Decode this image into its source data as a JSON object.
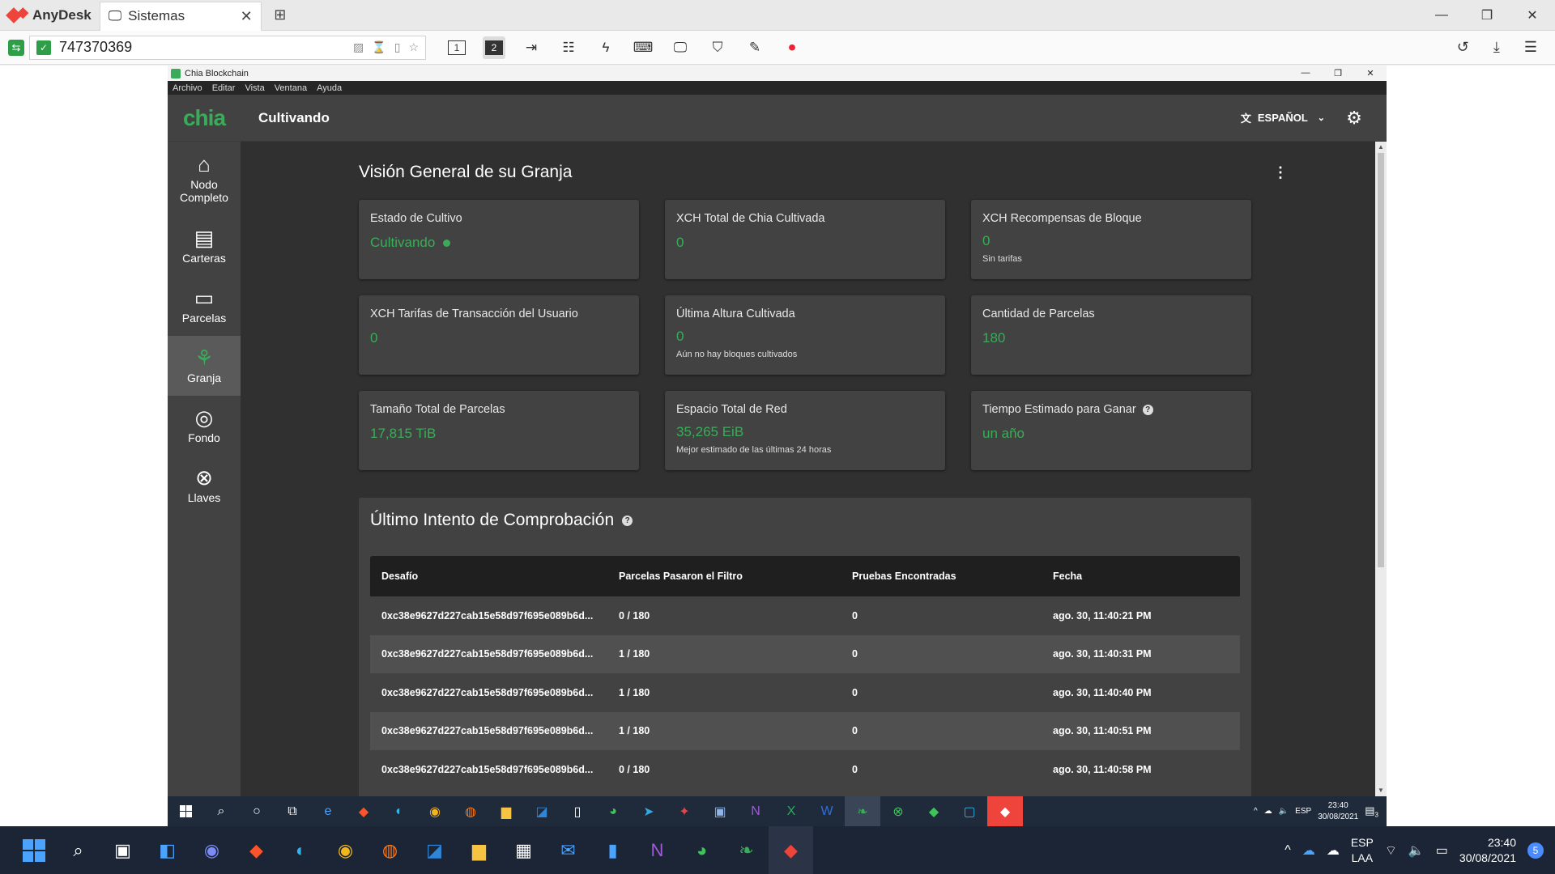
{
  "anydesk": {
    "app_name": "AnyDesk",
    "tab_label": "Sistemas",
    "address": "747370369"
  },
  "chia": {
    "window_title": "Chia Blockchain",
    "menu": [
      "Archivo",
      "Editar",
      "Vista",
      "Ventana",
      "Ayuda"
    ],
    "logo": "chia",
    "page_title": "Cultivando",
    "language": "ESPAÑOL",
    "sidebar": [
      {
        "label": "Nodo Completo",
        "icon": "home-icon"
      },
      {
        "label": "Carteras",
        "icon": "wallet-icon"
      },
      {
        "label": "Parcelas",
        "icon": "drive-icon"
      },
      {
        "label": "Granja",
        "icon": "sprout-icon"
      },
      {
        "label": "Fondo",
        "icon": "pool-icon"
      },
      {
        "label": "Llaves",
        "icon": "keys-icon"
      }
    ],
    "overview_title": "Visión General de su Granja",
    "cards": [
      {
        "label": "Estado de Cultivo",
        "value": "Cultivando",
        "sub": ""
      },
      {
        "label": "XCH Total de Chia Cultivada",
        "value": "0",
        "sub": ""
      },
      {
        "label": "XCH Recompensas de Bloque",
        "value": "0",
        "sub": "Sin tarifas"
      },
      {
        "label": "XCH Tarifas de Transacción del Usuario",
        "value": "0",
        "sub": ""
      },
      {
        "label": "Última Altura Cultivada",
        "value": "0",
        "sub": "Aún no hay bloques cultivados"
      },
      {
        "label": "Cantidad de Parcelas",
        "value": "180",
        "sub": ""
      },
      {
        "label": "Tamaño Total de Parcelas",
        "value": "17,815 TiB",
        "sub": ""
      },
      {
        "label": "Espacio Total de Red",
        "value": "35,265 EiB",
        "sub": "Mejor estimado de las últimas 24 horas"
      },
      {
        "label": "Tiempo Estimado para Ganar",
        "value": "un año",
        "sub": ""
      }
    ],
    "proof_title": "Último Intento de Comprobación",
    "table": {
      "headers": [
        "Desafío",
        "Parcelas Pasaron el Filtro",
        "Pruebas Encontradas",
        "Fecha"
      ],
      "rows": [
        [
          "0xc38e9627d227cab15e58d97f695e089b6d...",
          "0 / 180",
          "0",
          "ago. 30, 11:40:21 PM"
        ],
        [
          "0xc38e9627d227cab15e58d97f695e089b6d...",
          "1 / 180",
          "0",
          "ago. 30, 11:40:31 PM"
        ],
        [
          "0xc38e9627d227cab15e58d97f695e089b6d...",
          "1 / 180",
          "0",
          "ago. 30, 11:40:40 PM"
        ],
        [
          "0xc38e9627d227cab15e58d97f695e089b6d...",
          "1 / 180",
          "0",
          "ago. 30, 11:40:51 PM"
        ],
        [
          "0xc38e9627d227cab15e58d97f695e089b6d...",
          "0 / 180",
          "0",
          "ago. 30, 11:40:58 PM"
        ]
      ]
    }
  },
  "remote_taskbar": {
    "lang": "ESP",
    "time": "23:40",
    "date": "30/08/2021",
    "notif": "3"
  },
  "local_taskbar": {
    "lang_top": "ESP",
    "lang_bottom": "LAA",
    "time": "23:40",
    "date": "30/08/2021",
    "badge": "5"
  },
  "colors": {
    "accent": "#3aac59",
    "bg": "#303030",
    "card": "#424242"
  }
}
